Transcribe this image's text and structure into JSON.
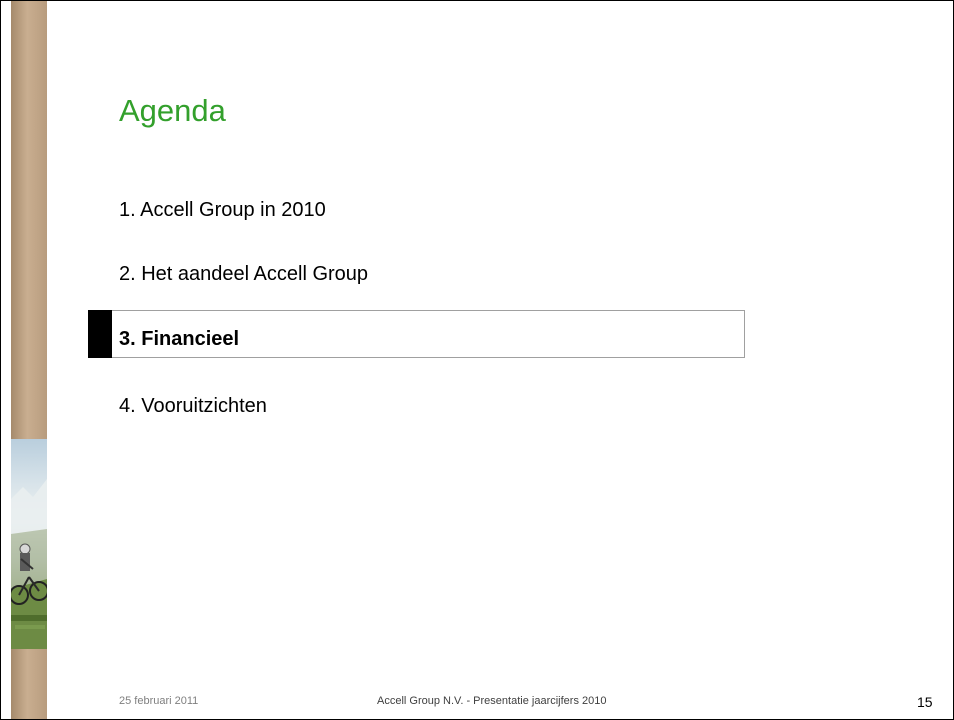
{
  "slide": {
    "title": "Agenda",
    "items": [
      {
        "label": "1. Accell Group in 2010",
        "active": false
      },
      {
        "label": "2. Het aandeel Accell Group",
        "active": false
      },
      {
        "label": "3. Financieel",
        "active": true
      },
      {
        "label": "4. Vooruitzichten",
        "active": false
      }
    ]
  },
  "footer": {
    "date": "25 februari 2011",
    "center": "Accell Group N.V. - Presentatie jaarcijfers 2010",
    "page_number": "15"
  },
  "colors": {
    "title": "#33a02c",
    "highlight_marker": "#000000",
    "highlight_border": "#a0a0a0",
    "strip": "#c9ae90"
  },
  "images": {
    "strip_photo": "mountain-biker-photo"
  }
}
